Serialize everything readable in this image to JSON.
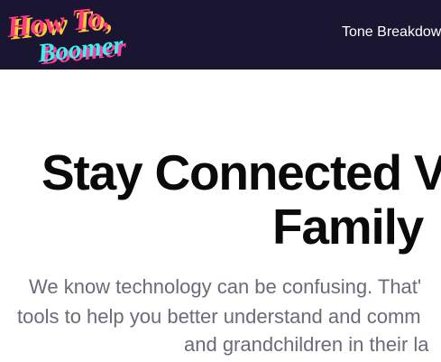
{
  "header": {
    "logo": {
      "line1": "How To,",
      "line2": "Boomer",
      "line1_color": "#ff3d7a",
      "line1_shadow": "#ffc93c",
      "line2_color": "#3cf0f0",
      "line2_shadow": "#ff3d9a"
    },
    "nav": {
      "tone_breakdown": "Tone Breakdow"
    },
    "background": "#1a1531"
  },
  "hero": {
    "title_line1": "Stay Connected V",
    "title_line2": "Family",
    "subtitle_line1": "We know technology can be confusing. That'",
    "subtitle_line2": "tools to help you better understand and comm",
    "subtitle_line3": "and grandchildren in their la"
  }
}
